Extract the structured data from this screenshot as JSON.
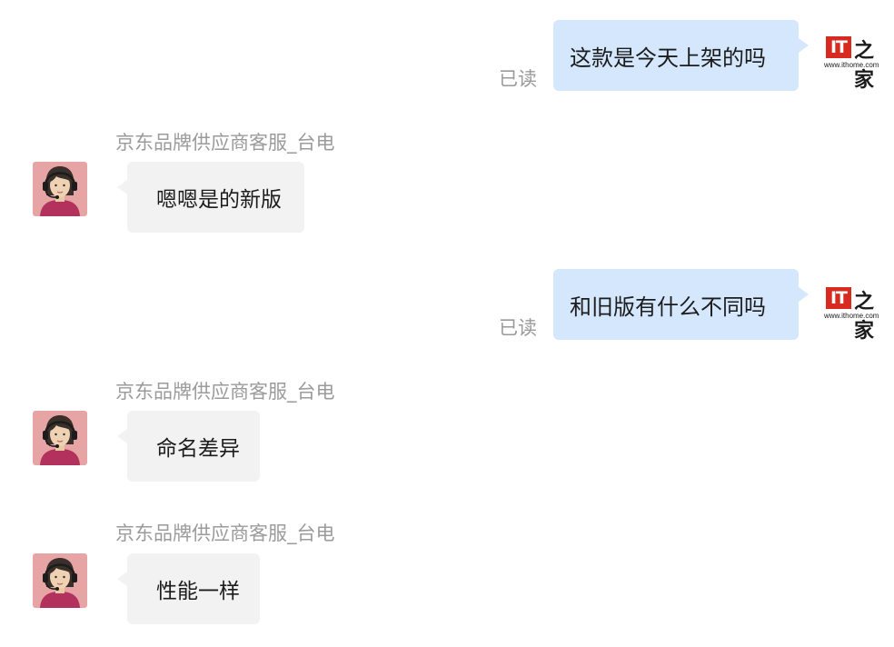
{
  "messages": [
    {
      "direction": "outgoing",
      "text": "这款是今天上架的吗",
      "status": "已读"
    },
    {
      "direction": "incoming",
      "sender": "京东品牌供应商客服_台电",
      "text": "嗯嗯是的新版"
    },
    {
      "direction": "outgoing",
      "text": "和旧版有什么不同吗",
      "status": "已读"
    },
    {
      "direction": "incoming",
      "sender": "京东品牌供应商客服_台电",
      "text": "命名差异"
    },
    {
      "direction": "incoming",
      "sender": "京东品牌供应商客服_台电",
      "text": "性能一样"
    }
  ],
  "watermark": {
    "logo": "IT",
    "logo_zh": "之家",
    "url": "www.ithome.com"
  },
  "colors": {
    "outgoing_bubble": "#d4e7fd",
    "incoming_bubble": "#f2f2f2",
    "avatar_bg": "#e7a4a4",
    "logo_red": "#d82a20"
  },
  "icons": {
    "agent_avatar": "customer-service-agent-headset-avatar"
  }
}
